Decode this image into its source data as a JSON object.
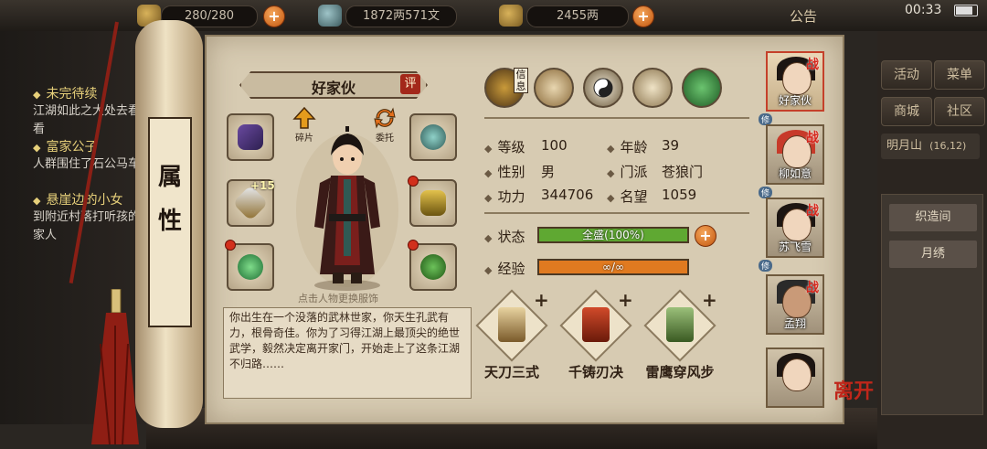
{
  "topbar": {
    "stamina": "280/280",
    "money": "1872两571文",
    "gold": "2455两",
    "notice": "公告",
    "clock": "00:33"
  },
  "quests": [
    {
      "title": "未完待续",
      "text": "江湖如此之大处去看看"
    },
    {
      "title": "富家公子",
      "text": "人群围住了石公马车"
    },
    {
      "title": "悬崖边的小女",
      "text": "到附近村落打听孩的家人"
    }
  ],
  "right_ui": {
    "buttons": [
      "活动",
      "菜单",
      "商城",
      "社区"
    ],
    "location": "明月山",
    "location_coords": "(16,12)",
    "sub_buttons": [
      "织造间",
      "月绣"
    ]
  },
  "panel": {
    "scroll_title": "属性",
    "character_name": "好家伙",
    "rate_label": "评",
    "shard_label": "碎片",
    "entrust_label": "委托",
    "info_tab_label": "信息",
    "equipment_level": "+15",
    "hint": "点击人物更换服饰",
    "description": "你出生在一个没落的武林世家，你天生孔武有力，根骨奇佳。你为了习得江湖上最顶尖的绝世武学，毅然决定离开家门，开始走上了这条江湖不归路……"
  },
  "attributes": {
    "level_label": "等级",
    "level": "100",
    "age_label": "年龄",
    "age": "39",
    "gender_label": "性别",
    "gender": "男",
    "sect_label": "门派",
    "sect": "苍狼门",
    "power_label": "功力",
    "power": "344706",
    "fame_label": "名望",
    "fame": "1059"
  },
  "status": {
    "label": "状态",
    "text": "全盛(100%)",
    "percent": 100,
    "color": "#5fa832"
  },
  "experience": {
    "label": "经验",
    "text": "∞/∞",
    "percent": 100,
    "color": "#e07a20"
  },
  "skills": [
    {
      "name": "天刀三式"
    },
    {
      "name": "千铸刃决"
    },
    {
      "name": "雷鹰穿风步"
    }
  ],
  "team": [
    {
      "name": "好家伙"
    },
    {
      "name": "柳如意"
    },
    {
      "name": "苏飞雪"
    },
    {
      "name": "孟翔"
    },
    {
      "name": ""
    }
  ],
  "team_badge_fight": "战",
  "team_badge_cultivate": "修",
  "leave_label": "离开",
  "colors": {
    "parchment": "#d7cbb2",
    "accent_red": "#c5402a",
    "status_green": "#5fa832",
    "exp_orange": "#e07a20"
  }
}
